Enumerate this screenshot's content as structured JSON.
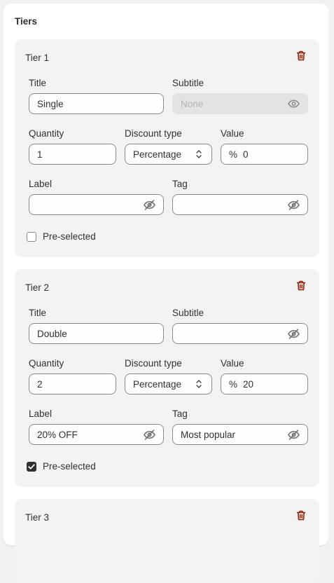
{
  "section_title": "Tiers",
  "field_labels": {
    "title": "Title",
    "subtitle": "Subtitle",
    "quantity": "Quantity",
    "discount_type": "Discount type",
    "value": "Value",
    "label": "Label",
    "tag": "Tag",
    "preselected": "Pre-selected"
  },
  "value_prefix": "%",
  "icons": {
    "delete": "trash-icon",
    "visible": "eye-icon",
    "hidden": "eye-off-icon",
    "select": "chevron-up-down-icon",
    "check": "checkmark-icon"
  },
  "colors": {
    "delete_icon": "#8e1f0b",
    "checkbox_checked": "#303030"
  },
  "tiers": [
    {
      "name": "Tier 1",
      "title": "Single",
      "subtitle": "",
      "subtitle_placeholder": "None",
      "subtitle_disabled": true,
      "quantity": "1",
      "discount_type": "Percentage",
      "value": "0",
      "label": "",
      "tag": "",
      "preselected": false
    },
    {
      "name": "Tier 2",
      "title": "Double",
      "subtitle": "",
      "quantity": "2",
      "discount_type": "Percentage",
      "value": "20",
      "label": "20% OFF",
      "tag": "Most popular",
      "preselected": true
    },
    {
      "name": "Tier 3"
    }
  ]
}
